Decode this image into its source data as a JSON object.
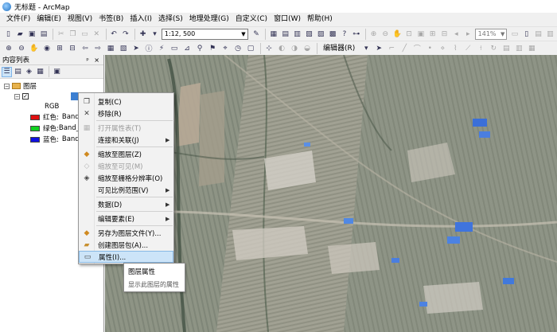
{
  "window": {
    "title": "无标题 - ArcMap"
  },
  "menubar": {
    "items": [
      "文件(F)",
      "编辑(E)",
      "视图(V)",
      "书签(B)",
      "插入(I)",
      "选择(S)",
      "地理处理(G)",
      "自定义(C)",
      "窗口(W)",
      "帮助(H)"
    ]
  },
  "toolbar": {
    "scale": "1:12, 500",
    "zoom": "141%",
    "editor_label": "编辑器(R)"
  },
  "toc": {
    "title": "内容列表",
    "pin": "ᵖ ×",
    "root_label": "图层",
    "rgb_label": "RGB",
    "bands": [
      {
        "label": "红色:",
        "band": "Band_",
        "color": "#e01010"
      },
      {
        "label": "绿色:",
        "band": "Band_2",
        "color": "#10d020"
      },
      {
        "label": "蓝色:",
        "band": "Band_",
        "color": "#1010e0"
      }
    ]
  },
  "context_menu": {
    "copy": "复制(C)",
    "remove": "移除(R)",
    "open_attr": "打开属性表(T)",
    "joins": "连接和关联(J)",
    "zoom_layer": "缩放至图层(Z)",
    "zoom_visible": "缩放至可见(M)",
    "zoom_raster": "缩放至栅格分辨率(O)",
    "visible_scale": "可见比例范围(V)",
    "data": "数据(D)",
    "edit_features": "编辑要素(E)",
    "save_layer": "另存为图层文件(Y)...",
    "create_package": "创建图层包(A)...",
    "properties": "属性(I)..."
  },
  "tooltip": {
    "title": "图层属性",
    "desc": "显示此图层的属性"
  }
}
